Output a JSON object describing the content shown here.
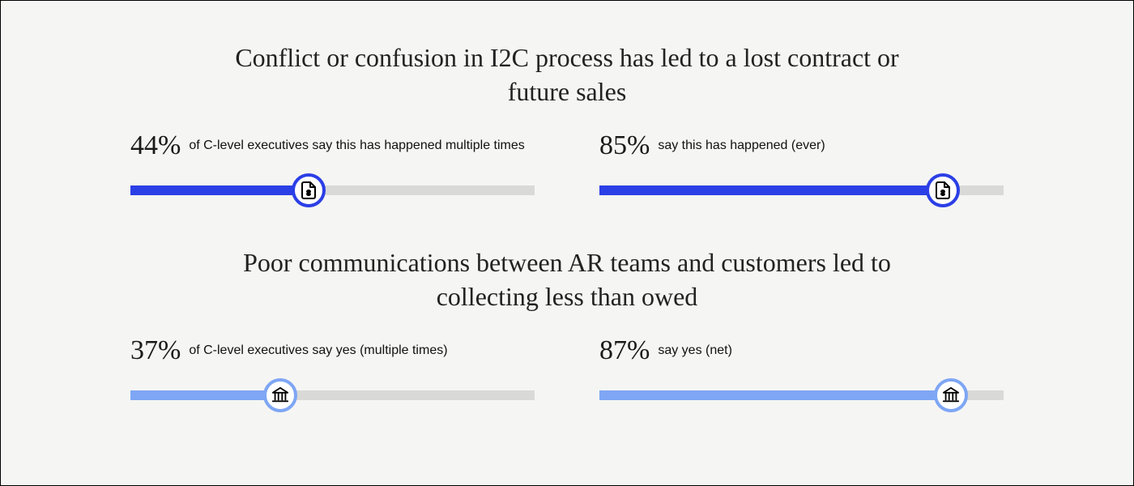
{
  "colors": {
    "primary": "#2b3fe6",
    "secondary": "#7ea6f4",
    "track": "#d9d9d7"
  },
  "sections": [
    {
      "title": "Conflict or confusion in I2C process has led to a lost contract or future sales",
      "icon": "invoice",
      "color": "#2b3fe6",
      "bars": [
        {
          "pct": "44%",
          "value": 44,
          "desc": "of C-level executives say this has happened multiple times"
        },
        {
          "pct": "85%",
          "value": 85,
          "desc": "say this has happened (ever)"
        }
      ]
    },
    {
      "title": "Poor communications between AR teams and customers led to collecting less than owed",
      "icon": "bank",
      "color": "#7ea6f4",
      "bars": [
        {
          "pct": "37%",
          "value": 37,
          "desc": "of C-level executives say yes (multiple times)"
        },
        {
          "pct": "87%",
          "value": 87,
          "desc": "say yes (net)"
        }
      ]
    }
  ],
  "chart_data": [
    {
      "type": "bar",
      "title": "Conflict or confusion in I2C process has led to a lost contract or future sales",
      "categories": [
        "multiple times",
        "ever"
      ],
      "values": [
        44,
        85
      ],
      "ylabel": "% of C-level executives",
      "ylim": [
        0,
        100
      ]
    },
    {
      "type": "bar",
      "title": "Poor communications between AR teams and customers led to collecting less than owed",
      "categories": [
        "yes (multiple times)",
        "yes (net)"
      ],
      "values": [
        37,
        87
      ],
      "ylabel": "% of C-level executives",
      "ylim": [
        0,
        100
      ]
    }
  ]
}
